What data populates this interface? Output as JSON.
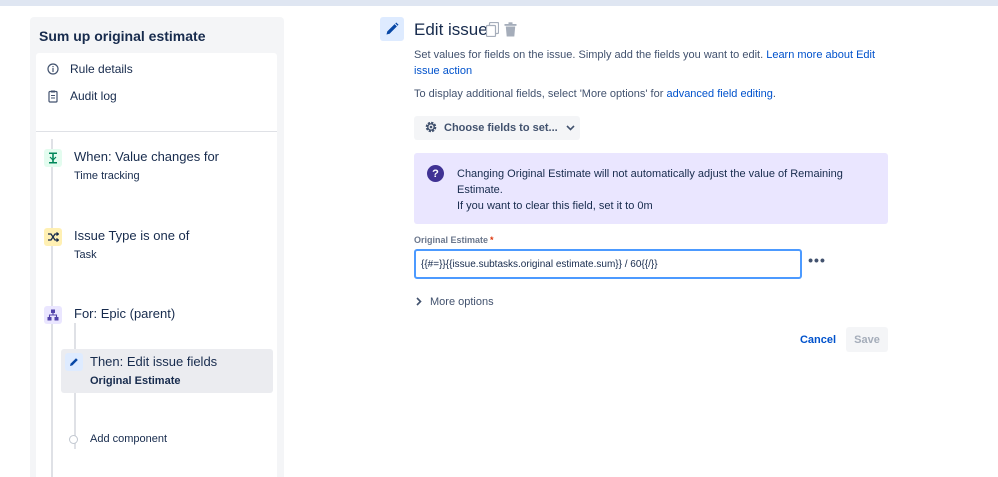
{
  "sidebar": {
    "title": "Sum up original estimate",
    "links": [
      {
        "label": "Rule details",
        "icon": "info-icon"
      },
      {
        "label": "Audit log",
        "icon": "clipboard-icon"
      }
    ],
    "steps": [
      {
        "title": "When: Value changes for",
        "subtitle": "Time tracking",
        "icon": "trigger-icon",
        "color": "#e3fcef"
      },
      {
        "title": "Issue Type is one of",
        "subtitle": "Task",
        "icon": "condition-icon",
        "color": "#fff0b3"
      },
      {
        "title": "For: Epic (parent)",
        "subtitle": "",
        "icon": "branch-icon",
        "color": "#eae6ff"
      }
    ],
    "action": {
      "title": "Then: Edit issue fields",
      "subtitle": "Original Estimate"
    },
    "add_component": "Add component"
  },
  "main": {
    "title": "Edit issue",
    "description": "Set values for fields on the issue. Simply add the fields you want to edit.",
    "learn_more_link": "Learn more about Edit issue action",
    "additional_text": "To display additional fields, select 'More options' for",
    "advanced_link": "advanced field editing",
    "additional_end": ".",
    "choose_fields": "Choose fields to set...",
    "info_line1": "Changing Original Estimate will not automatically adjust the value of Remaining Estimate.",
    "info_line2": "If you want to clear this field, set it to 0m",
    "field_label": "Original Estimate",
    "field_required": "*",
    "field_value": "{{#=}}{{issue.subtasks.original estimate.sum}} / 60{{/}}",
    "more_options": "More options",
    "cancel": "Cancel",
    "save": "Save"
  },
  "colors": {
    "accent": "#0052cc",
    "info_bg": "#eae6ff",
    "focus": "#4c9aff"
  }
}
